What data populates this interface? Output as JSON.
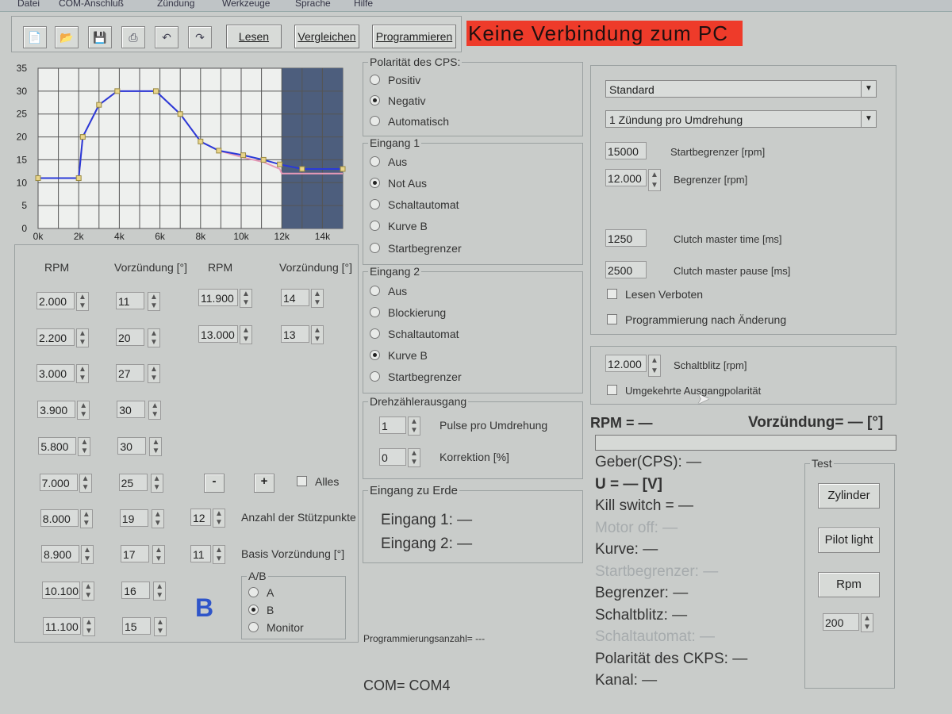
{
  "menu": [
    "Datei",
    "COM-Anschluß",
    "Zündung",
    "Werkzeuge",
    "Sprache",
    "Hilfe"
  ],
  "toolbar": {
    "icons": [
      "new-file-icon",
      "open-folder-icon",
      "save-icon",
      "print-icon",
      "undo-icon",
      "redo-icon"
    ],
    "lesen": "Lesen",
    "vergleichen": "Vergleichen",
    "programmieren": "Programmieren"
  },
  "status": {
    "connection": "Keine Verbindung zum PC",
    "color": "#ee3b2a"
  },
  "chart_data": {
    "type": "line",
    "x_ticks": [
      "0k",
      "2k",
      "4k",
      "6k",
      "8k",
      "10k",
      "12k",
      "14k"
    ],
    "y_ticks": [
      "35",
      "30",
      "25",
      "20",
      "15",
      "10",
      "5",
      "0"
    ],
    "xlim": [
      0,
      15000
    ],
    "ylim": [
      0,
      35
    ],
    "grid": true,
    "limiter_rpm": 12000,
    "series": [
      {
        "color": "#2a3ad8",
        "x": [
          0,
          2000,
          2200,
          3000,
          3900,
          5800,
          7000,
          8000,
          8900,
          10100,
          11100,
          11900,
          13000,
          15000
        ],
        "y": [
          11,
          11,
          20,
          27,
          30,
          30,
          25,
          19,
          17,
          16,
          15,
          14,
          13,
          13
        ]
      },
      {
        "color": "#e89ab8",
        "x": [
          0,
          2000,
          2200,
          3000,
          3900,
          5800,
          7000,
          8000,
          8900,
          10100,
          11100,
          11900,
          12000,
          13000,
          15000
        ],
        "y": [
          11,
          11,
          20,
          27,
          30,
          30,
          25,
          19,
          17,
          15.5,
          14.5,
          13,
          12,
          12,
          12
        ]
      }
    ]
  },
  "curve": {
    "headers": {
      "rpm": "RPM",
      "adv": "Vorzündung [°]"
    },
    "left": [
      {
        "rpm": "2.000",
        "adv": "11"
      },
      {
        "rpm": "2.200",
        "adv": "20"
      },
      {
        "rpm": "3.000",
        "adv": "27"
      },
      {
        "rpm": "3.900",
        "adv": "30"
      },
      {
        "rpm": "5.800",
        "adv": "30"
      },
      {
        "rpm": "7.000",
        "adv": "25"
      },
      {
        "rpm": "8.000",
        "adv": "19"
      },
      {
        "rpm": "8.900",
        "adv": "17"
      },
      {
        "rpm": "10.100",
        "adv": "16"
      },
      {
        "rpm": "11.100",
        "adv": "15"
      }
    ],
    "right": [
      {
        "rpm": "11.900",
        "adv": "14"
      },
      {
        "rpm": "13.000",
        "adv": "13"
      }
    ],
    "minus": "-",
    "plus": "+",
    "alles": "Alles",
    "stuetzpunkte_value": "12",
    "stuetzpunkte_label": "Anzahl der Stützpunkte",
    "basis_value": "11",
    "basis_label": "Basis Vorzündung [°]",
    "curve_letter": "B",
    "ab_group": "A/B",
    "ab_options": [
      "A",
      "B",
      "Monitor"
    ]
  },
  "cps": {
    "title": "Polarität des CPS:",
    "options": [
      "Positiv",
      "Negativ",
      "Automatisch"
    ],
    "selected": 1
  },
  "eingang1": {
    "title": "Eingang 1",
    "options": [
      "Aus",
      "Not Aus",
      "Schaltautomat",
      "Kurve B",
      "Startbegrenzer"
    ],
    "selected": 1
  },
  "eingang2": {
    "title": "Eingang 2",
    "options": [
      "Aus",
      "Blockierung",
      "Schaltautomat",
      "Kurve B",
      "Startbegrenzer"
    ],
    "selected": 3
  },
  "tacho": {
    "title": "Drehzählerausgang",
    "pulse_value": "1",
    "pulse_label": "Pulse pro Umdrehung",
    "korr_value": "0",
    "korr_label": "Korrektion [%]"
  },
  "erde": {
    "title": "Eingang zu Erde",
    "e1": "Eingang 1: —",
    "e2": "Eingang 2: —"
  },
  "prog_count": "Programmierungsanzahl= ---",
  "com": "COM= COM4",
  "settings": {
    "mode": "Standard",
    "ign": "1 Zündung pro Umdrehung",
    "start_value": "15000",
    "start_label": "Startbegrenzer [rpm]",
    "limit_value": "12.000",
    "limit_label": "Begrenzer [rpm]",
    "clutch_time_value": "1250",
    "clutch_time_label": "Clutch master time [ms]",
    "clutch_pause_value": "2500",
    "clutch_pause_label": "Clutch master pause [ms]",
    "lesen_verboten": "Lesen Verboten",
    "prog_nach": "Programmierung nach Änderung"
  },
  "schaltblitz": {
    "value": "12.000",
    "label": "Schaltblitz [rpm]",
    "invert": "Umgekehrte Ausgangpolarität"
  },
  "monitor": {
    "rpm": "RPM = —",
    "vorz": "Vorzündung= — [°]",
    "lines": [
      {
        "text": "Geber(CPS): —",
        "faded": false
      },
      {
        "text": "U = — [V]",
        "faded": false
      },
      {
        "text": "Kill switch = —",
        "faded": false
      },
      {
        "text": "Motor off: —",
        "faded": true
      },
      {
        "text": "Kurve: —",
        "faded": false
      },
      {
        "text": "Startbegrenzer: —",
        "faded": true
      },
      {
        "text": "Begrenzer: —",
        "faded": false
      },
      {
        "text": "Schaltblitz: —",
        "faded": false
      },
      {
        "text": "Schaltautomat: —",
        "faded": true
      },
      {
        "text": "Polarität des CKPS: —",
        "faded": false
      },
      {
        "text": "Kanal: —",
        "faded": false
      }
    ]
  },
  "test": {
    "title": "Test",
    "zylinder": "Zylinder",
    "pilot": "Pilot light",
    "rpm": "Rpm",
    "rpm_value": "200"
  }
}
